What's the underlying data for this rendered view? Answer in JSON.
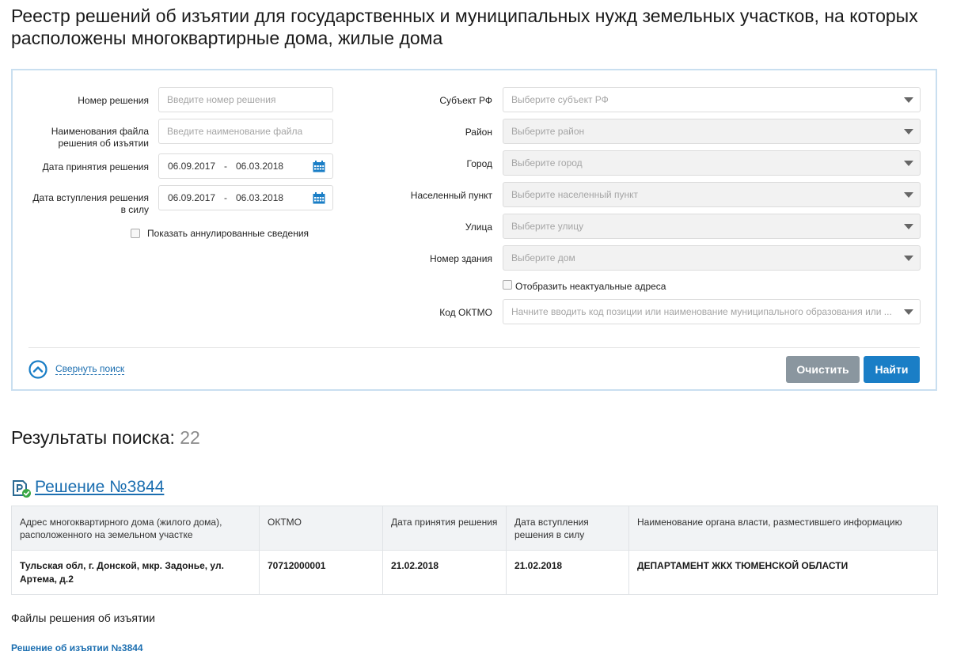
{
  "page": {
    "title": "Реестр решений об изъятии для государственных и муниципальных нужд земельных участков, на которых расположены многоквартирные дома, жилые дома"
  },
  "search": {
    "decision_number": {
      "label": "Номер решения",
      "placeholder": "Введите номер решения"
    },
    "file_name": {
      "label_line1": "Наименования файла",
      "label_line2": "решения об изъятии",
      "placeholder": "Введите наименование файла"
    },
    "adoption_date": {
      "label": "Дата принятия решения",
      "from": "06.09.2017",
      "to": "06.03.2018",
      "separator": "-"
    },
    "effective_date": {
      "label_line1": "Дата вступления решения",
      "label_line2": "в силу",
      "from": "06.09.2017",
      "to": "06.03.2018",
      "separator": "-"
    },
    "show_annulled": {
      "label": "Показать аннулированные сведения",
      "checked": false
    },
    "subject": {
      "label": "Субъект РФ",
      "placeholder": "Выберите субъект РФ"
    },
    "district": {
      "label": "Район",
      "placeholder": "Выберите район"
    },
    "city": {
      "label": "Город",
      "placeholder": "Выберите город"
    },
    "settlement": {
      "label": "Населенный пункт",
      "placeholder": "Выберите населенный пункт"
    },
    "street": {
      "label": "Улица",
      "placeholder": "Выберите улицу"
    },
    "building": {
      "label": "Номер здания",
      "placeholder": "Выберите дом"
    },
    "show_outdated": {
      "label": "Отобразить неактуальные адреса",
      "checked": false
    },
    "oktmo": {
      "label": "Код ОКТМО",
      "placeholder": "Начните вводить код позиции или наименование муниципального образования или ..."
    },
    "collapse_label": "Свернуть поиск",
    "clear_label": "Очистить",
    "find_label": "Найти"
  },
  "results": {
    "title": "Результаты поиска:",
    "count": "22",
    "decision": {
      "title": "Решение №3844",
      "columns": [
        "Адрес многоквартирного дома (жилого дома), расположенного на земельном участке",
        "ОКТМО",
        "Дата принятия решения",
        "Дата вступления решения в силу",
        "Наименование органа власти, разместившего информацию"
      ],
      "rows": [
        [
          "Тульская обл, г. Донской, мкр. Задонье, ул. Артема, д.2",
          "70712000001",
          "21.02.2018",
          "21.02.2018",
          "ДЕПАРТАМЕНТ ЖКХ ТЮМЕНСКОЙ ОБЛАСТИ"
        ]
      ],
      "files_title": "Файлы решения об изъятии",
      "file_link": "Решение об изъятии №3844"
    }
  },
  "colors": {
    "accent": "#1a7ec6",
    "link": "#1b6eb0",
    "clear_button": "#8a969f",
    "panel_border": "#c9dff0",
    "status_ok": "#3aa845"
  },
  "icons": {
    "calendar": "calendar-icon",
    "dropdown": "chevron-down-icon",
    "collapse": "chevron-up-circle-icon",
    "decision": "document-check-icon"
  }
}
